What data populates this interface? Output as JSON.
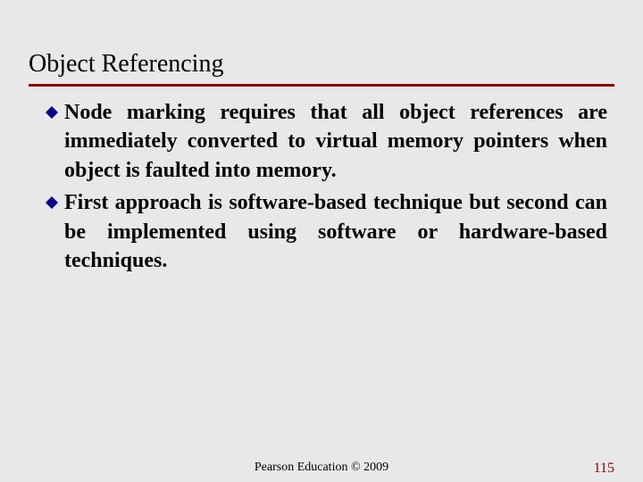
{
  "title": "Object Referencing",
  "bullets": [
    {
      "text": "Node marking requires that all object references are immediately converted to virtual memory pointers when object is faulted into memory."
    },
    {
      "text": "First approach is software-based technique but second can be implemented using software or hardware-based techniques."
    }
  ],
  "footer": {
    "center": "Pearson Education © 2009",
    "page": "115"
  },
  "colors": {
    "accent": "#8b0000",
    "bullet": "#00008b"
  }
}
